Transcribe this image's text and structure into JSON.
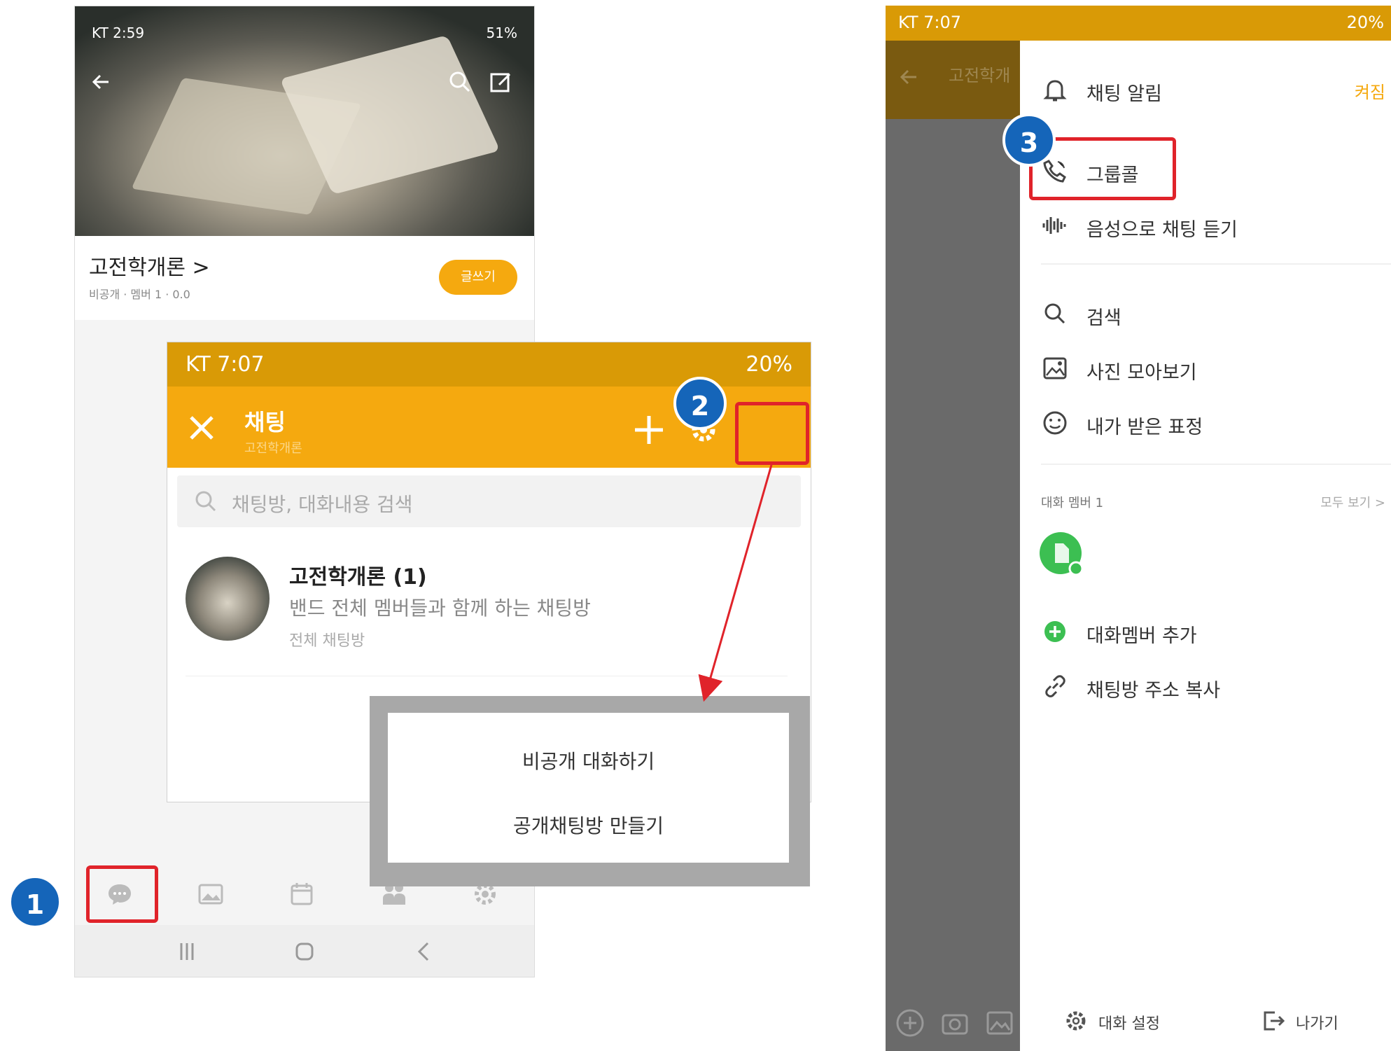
{
  "phone_a": {
    "status_bar": {
      "left": "KT 2:59",
      "right": "51%"
    },
    "band": {
      "title": "고전학개론 >",
      "meta": "비공개 · 멤버 1 · 0.0",
      "write_button": "글쓰기"
    },
    "tabs": [
      "chat-icon",
      "photo-icon",
      "calendar-icon",
      "members-icon",
      "settings-icon"
    ]
  },
  "chat_panel": {
    "status_bar": {
      "left": "KT 7:07",
      "right": "20%"
    },
    "title": "채팅",
    "subtitle": "고전학개론",
    "search_placeholder": "채팅방, 대화내용 검색",
    "room": {
      "name": "고전학개론 (1)",
      "description": "밴드 전체 멤버들과 함께 하는 채팅방",
      "type": "전체 채팅방"
    }
  },
  "popup_menu": {
    "items": [
      "비공개 대화하기",
      "공개채팅방 만들기"
    ]
  },
  "phone_b": {
    "status_bar": {
      "left": "KT 7:07",
      "right": "20%"
    },
    "dim_title": "고전학개",
    "alarm": {
      "label": "채팅 알림",
      "state": "켜짐"
    },
    "group_call": "그룹콜",
    "voice_listen": "음성으로 채팅 듣기",
    "search": "검색",
    "photos": "사진 모아보기",
    "reactions": "내가 받은 표정",
    "members_header": "대화 멤버 1",
    "see_all": "모두 보기 >",
    "add_member": "대화멤버 추가",
    "copy_link": "채팅방 주소 복사",
    "footer": {
      "settings": "대화 설정",
      "leave": "나가기"
    }
  },
  "badges": [
    "1",
    "2",
    "3"
  ],
  "colors": {
    "accent": "#f5a90f",
    "accent_dark": "#d99a06",
    "annotation_red": "#e0232a",
    "badge_blue": "#1565b9",
    "member_green": "#3cbf52"
  }
}
